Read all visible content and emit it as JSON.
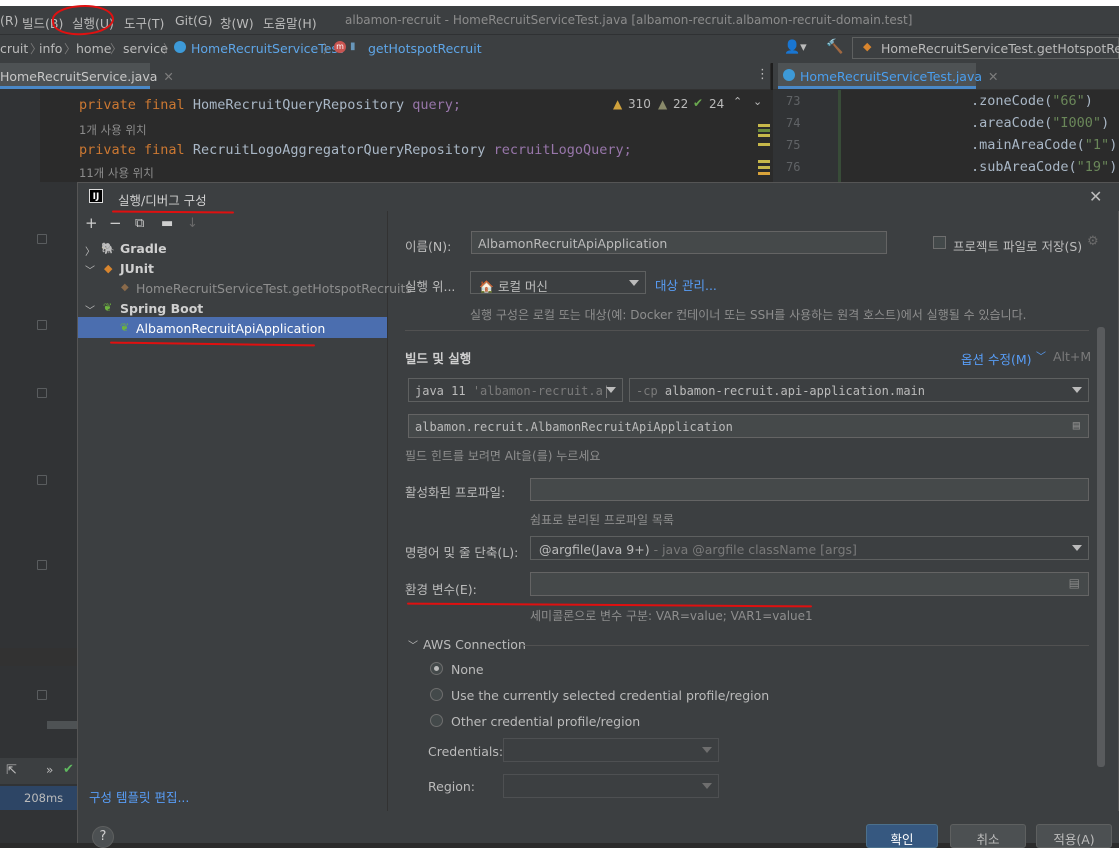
{
  "menu": {
    "items": [
      "(R)",
      "빌드(B)",
      "실행(U)",
      "도구(T)",
      "Git(G)",
      "창(W)",
      "도움말(H)"
    ],
    "window_title": "albamon-recruit - HomeRecruitServiceTest.java [albamon-recruit.albamon-recruit-domain.test]"
  },
  "nav": {
    "crumbs": [
      "cruit",
      "info",
      "home",
      "service",
      "HomeRecruitServiceTest",
      "getHotspotRecruit"
    ],
    "run_config": "HomeRecruitServiceTest.getHotspotRecruits"
  },
  "tabs": {
    "left": "HomeRecruitService.java",
    "right": "HomeRecruitServiceTest.java"
  },
  "editor_left": {
    "line1_kw": "private final",
    "line1_type": "HomeRecruitQueryRepository",
    "line1_field": "query;",
    "hint1": "1개 사용 위치",
    "line2_kw": "private final",
    "line2_type": "RecruitLogoAggregatorQueryRepository",
    "line2_field": "recruitLogoQuery;",
    "hint2": "11개 사용 위치",
    "warnings": "310",
    "weak_warnings": "22",
    "typos": "24"
  },
  "editor_right": {
    "lines": [
      {
        "num": "73",
        "method": ".zoneCode(",
        "arg": "\"66\"",
        "end": ")"
      },
      {
        "num": "74",
        "method": ".areaCode(",
        "arg": "\"I000\"",
        "end": ")"
      },
      {
        "num": "75",
        "method": ".mainAreaCode(",
        "arg": "\"1\"",
        "end": ")"
      },
      {
        "num": "76",
        "method": ".subAreaCode(",
        "arg": "\"19\"",
        "end": ")"
      }
    ]
  },
  "sidebar": {
    "run_time": "208ms"
  },
  "dialog": {
    "title": "실행/디버그 구성",
    "tree": {
      "gradle": "Gradle",
      "junit": "JUnit",
      "junit_child": "HomeRecruitServiceTest.getHotspotRecruits",
      "spring": "Spring Boot",
      "spring_child": "AlbamonRecruitApiApplication"
    },
    "edit_templates": "구성 템플릿 편집...",
    "name_label": "이름(N):",
    "name_value": "AlbamonRecruitApiApplication",
    "store_label": "프로젝트 파일로 저장(S)",
    "run_on_label": "실행 위...",
    "run_on_value": "로컬 머신",
    "manage_targets": "대상 관리...",
    "run_on_hint": "실행 구성은 로컬 또는 대상(예: Docker 컨테이너 또는 SSH를 사용하는 원격 호스트)에서 실행될 수 있습니다.",
    "build_run": "빌드 및 실행",
    "modify_options": "옵션 수정(M)",
    "modify_shortcut": "Alt+M",
    "jdk": "java 11",
    "jdk_hint": "'albamon-recruit.a|",
    "cp_flag": "-cp",
    "cp_value": "albamon-recruit.api-application.main",
    "main_class": "albamon.recruit.AlbamonRecruitApiApplication",
    "field_hint": "필드 힌트를 보려면 Alt을(를) 누르세요",
    "profiles_label": "활성화된 프로파일:",
    "profiles_hint": "쉼표로 분리된 프로파일 목록",
    "shorten_label": "명령어 및 줄 단축(L):",
    "shorten_value": "@argfile(Java 9+)",
    "shorten_hint": "- java @argfile className [args]",
    "env_label": "환경 변수(E):",
    "env_hint": "세미콜론으로 변수 구분: VAR=value; VAR1=value1",
    "aws_title": "AWS Connection",
    "aws_none": "None",
    "aws_current": "Use the currently selected credential profile/region",
    "aws_other": "Other credential profile/region",
    "credentials_label": "Credentials:",
    "region_label": "Region:",
    "ok": "확인",
    "cancel": "취소",
    "apply": "적용(A)"
  }
}
